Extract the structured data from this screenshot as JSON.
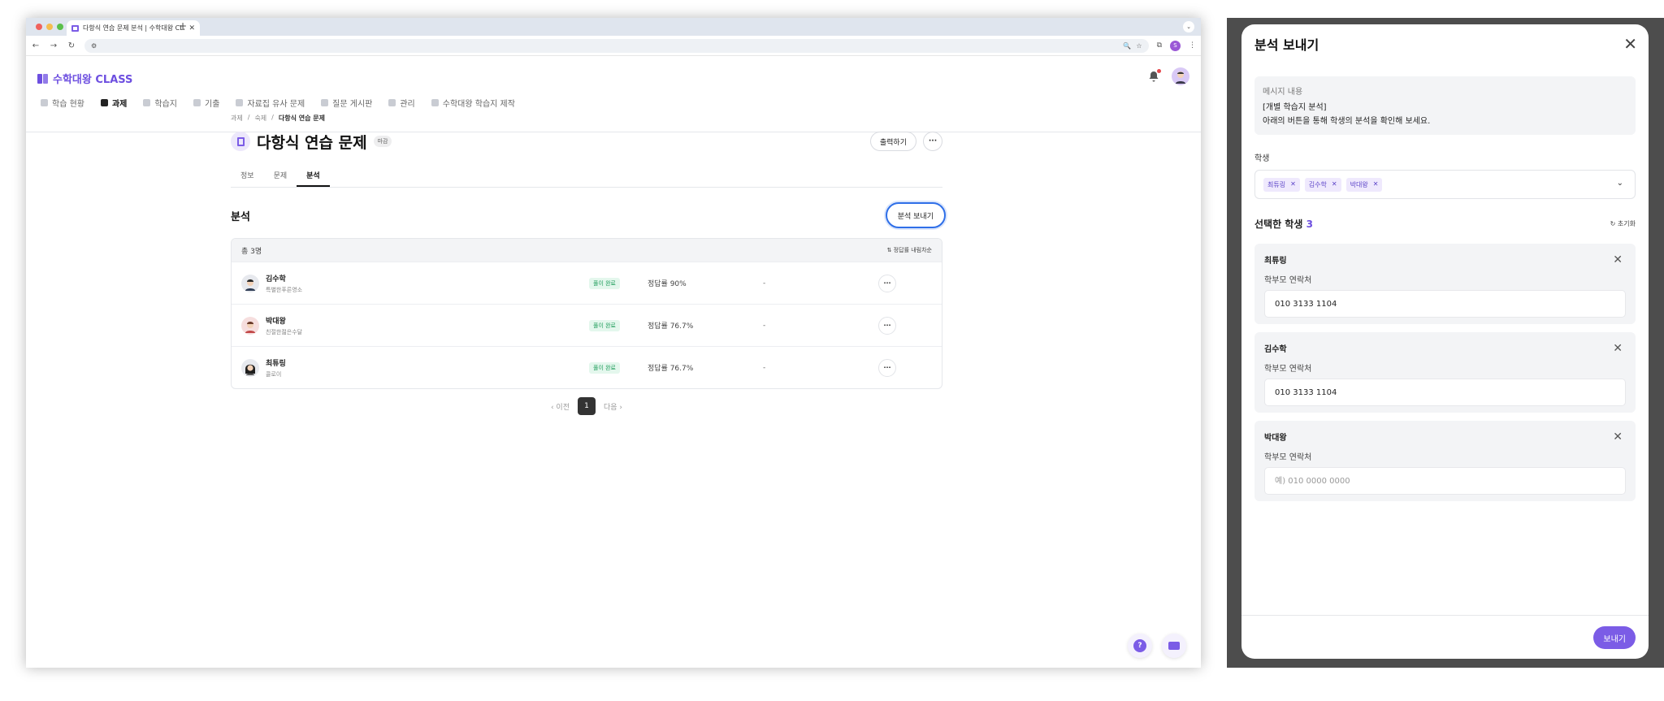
{
  "browser": {
    "tab_title": "다항식 연습 문제 분석 | 수학대왕 CLASS",
    "tab_close": "✕",
    "new_tab": "+",
    "profile_initial": "S"
  },
  "app": {
    "logo": "수학대왕 CLASS",
    "nav": [
      {
        "label": "학습 현황",
        "active": false
      },
      {
        "label": "과제",
        "active": true
      },
      {
        "label": "학습지",
        "active": false
      },
      {
        "label": "기출",
        "active": false
      },
      {
        "label": "자료집 유사 문제",
        "active": false
      },
      {
        "label": "질문 게시판",
        "active": false
      },
      {
        "label": "관리",
        "active": false
      },
      {
        "label": "수학대왕 학습지 제작",
        "active": false
      }
    ]
  },
  "page": {
    "breadcrumbs": [
      "과제",
      "숙제",
      "다항식 연습 문제"
    ],
    "breadcrumb_sep": "/",
    "title": "다항식 연습 문제",
    "deadline_badge": "마감",
    "print_button": "출력하기",
    "more": "···",
    "tabs": [
      {
        "label": "정보",
        "active": false
      },
      {
        "label": "문제",
        "active": false
      },
      {
        "label": "분석",
        "active": true
      }
    ],
    "section_title": "분석",
    "send_analysis_button": "분석 보내기",
    "table": {
      "total": "총 3명",
      "sort": "⇅ 정답률 내림차순",
      "rows": [
        {
          "name": "김수학",
          "school": "특별한푸른영소",
          "status": "풀이 완료",
          "rate": "정답률 90%",
          "extra": "-"
        },
        {
          "name": "박대왕",
          "school": "친절한젊은수달",
          "status": "풀이 완료",
          "rate": "정답률 76.7%",
          "extra": "-"
        },
        {
          "name": "최튜링",
          "school": "콜로이",
          "status": "풀이 완료",
          "rate": "정답률 76.7%",
          "extra": "-"
        }
      ]
    },
    "pagination": {
      "prev": "‹ 이전",
      "current": "1",
      "next": "다음 ›"
    }
  },
  "modal": {
    "title": "분석 보내기",
    "close": "✕",
    "message_label": "메시지 내용",
    "message_lines": [
      "[개별 학습지 분석]",
      "아래의 버튼을 통해 학생의 분석을 확인해 보세요."
    ],
    "students_label": "학생",
    "chips": [
      "최튜링",
      "김수학",
      "박대왕"
    ],
    "chip_remove": "✕",
    "chevron": "⌄",
    "selected_label": "선택한 학생",
    "selected_count": "3",
    "reset": "↻ 초기화",
    "parent_contact_label": "학부모 연락처",
    "cards": [
      {
        "name": "최튜링",
        "phone": "010 3133 1104"
      },
      {
        "name": "김수학",
        "phone": "010 3133 1104"
      },
      {
        "name": "박대왕",
        "phone": ""
      }
    ],
    "phone_placeholder": "예) 010 0000 0000",
    "send_button": "보내기"
  },
  "colors": {
    "brand": "#6d4fe0",
    "focus_ring": "#2f6fe8",
    "status_green": "#1f9d5b",
    "overlay": "#4d4d4d"
  }
}
